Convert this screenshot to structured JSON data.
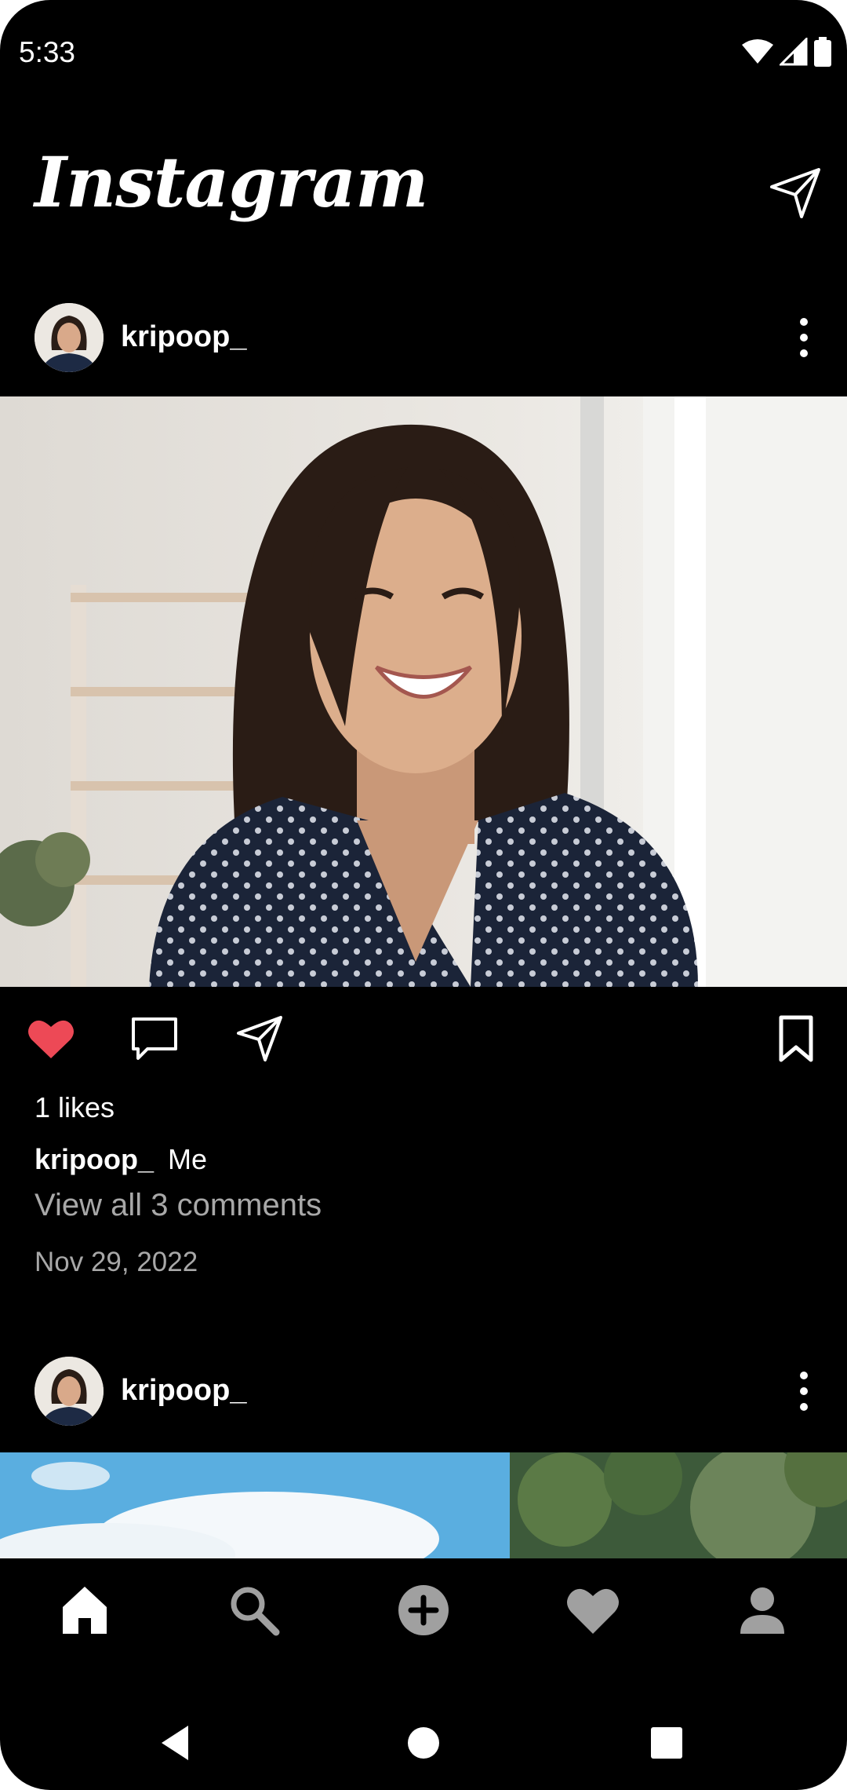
{
  "status_bar": {
    "time": "5:33"
  },
  "header": {
    "logo": "Instagram"
  },
  "posts": [
    {
      "username": "kripoop_",
      "likes": "1 likes",
      "caption_user": "kripoop_",
      "caption_text": "Me",
      "view_comments": "View all 3 comments",
      "date": "Nov 29, 2022",
      "liked": true
    },
    {
      "username": "kripoop_"
    }
  ],
  "icons": {
    "dm": "paper-plane-icon",
    "more": "more-vertical-icon",
    "like": "heart-filled-icon",
    "comment": "comment-icon",
    "share": "paper-plane-icon",
    "save": "bookmark-icon"
  },
  "bottom_nav": [
    "home-icon",
    "search-icon",
    "add-icon",
    "heart-icon",
    "profile-icon"
  ],
  "colors": {
    "background": "#000000",
    "like": "#ed4956",
    "muted_text": "#a8a8a8",
    "icon_inactive": "#a0a0a0"
  }
}
